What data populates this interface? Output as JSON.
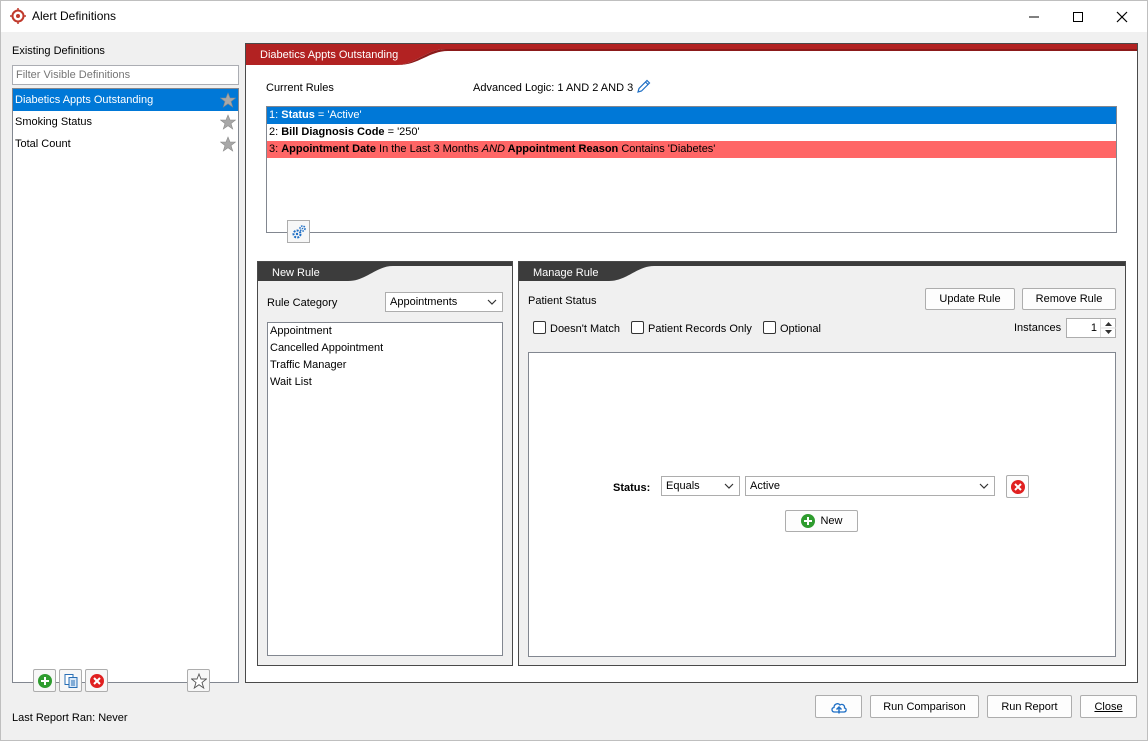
{
  "window": {
    "title": "Alert Definitions"
  },
  "left": {
    "heading": "Existing Definitions",
    "filter_placeholder": "Filter Visible Definitions",
    "definitions": [
      {
        "label": "Diabetics Appts Outstanding",
        "selected": true
      },
      {
        "label": "Smoking Status",
        "selected": false
      },
      {
        "label": "Total Count",
        "selected": false
      }
    ],
    "last_report": "Last Report Ran: Never"
  },
  "main": {
    "title": "Diabetics Appts Outstanding",
    "current_rules_label": "Current Rules",
    "advanced_logic": "Advanced Logic: 1 AND 2 AND 3",
    "rules": [
      {
        "prefix": "1: ",
        "field": "Status",
        "rest": " = 'Active'",
        "state": "selected"
      },
      {
        "prefix": "2: ",
        "field": "Bill Diagnosis Code",
        "rest": " = '250'",
        "state": "normal"
      },
      {
        "prefix": "3: ",
        "field": "Appointment Date",
        "mid": " In the Last 3 Months ",
        "conj": "AND",
        "field2": " Appointment Reason",
        "rest": " Contains 'Diabetes'",
        "state": "error"
      }
    ]
  },
  "new_rule": {
    "title": "New Rule",
    "category_label": "Rule Category",
    "category_value": "Appointments",
    "items": [
      "Appointment",
      "Cancelled Appointment",
      "Traffic Manager",
      "Wait List"
    ]
  },
  "manage_rule": {
    "title": "Manage Rule",
    "rule_name": "Patient Status",
    "update_label": "Update Rule",
    "remove_label": "Remove Rule",
    "doesnt_match": "Doesn't Match",
    "patient_records_only": "Patient Records Only",
    "optional": "Optional",
    "instances_label": "Instances",
    "instances_value": "1",
    "condition_field": "Status:",
    "operator": "Equals",
    "value": "Active",
    "new_label": "New"
  },
  "footer": {
    "run_comparison": "Run Comparison",
    "run_report": "Run Report",
    "close": "Close"
  },
  "colors": {
    "accent": "#b22222",
    "header_dark": "#3c3c3c",
    "selection": "#0078d7",
    "error_row": "#ff6666"
  }
}
